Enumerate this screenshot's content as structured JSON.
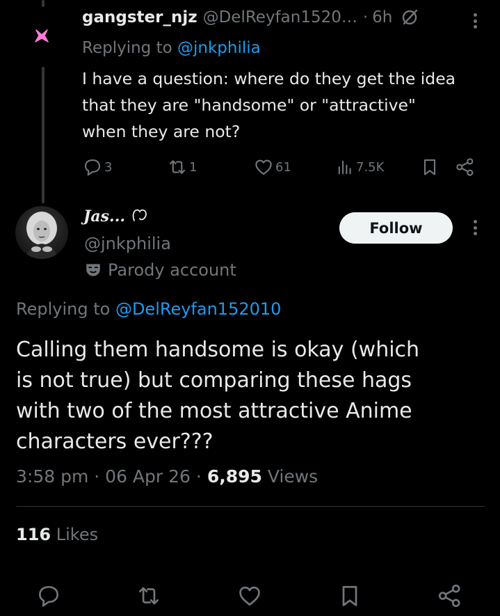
{
  "colors": {
    "background": "#000000",
    "primary_text": "#e7e9ea",
    "secondary_text": "#71767b",
    "link": "#1d9bf0",
    "follow_button_bg": "#eff3f4",
    "follow_button_text": "#0f1419",
    "divider": "#2f3336",
    "reply_avatar_accent": "#ff7ad9"
  },
  "reply": {
    "display_name": "gangster_njz",
    "handle": "@DelReyfan1520…",
    "separator": "·",
    "time": "6h",
    "grok_icon": "grok-icon",
    "avatar_icon": "pink-bunny-avatar",
    "replying_prefix": "Replying to",
    "replying_handle": "@jnkphilia",
    "text_lines": [
      "I have a question: where do they get the idea",
      "that they are \"handsome\" or \"attractive\"",
      "when they are not?"
    ],
    "actions": {
      "replies": "3",
      "reposts": "1",
      "likes": "61",
      "views": "7.5K"
    }
  },
  "main_tweet": {
    "display_name": "Jas...",
    "name_icon": "heart-outline-icon",
    "handle": "@jnkphilia",
    "avatar_icon": "profile-photo-avatar",
    "label_icon": "theater-mask-icon",
    "label_text": "Parody account",
    "follow_label": "Follow",
    "replying_prefix": "Replying to",
    "replying_handle": "@DelReyfan152010",
    "text_lines": [
      "Calling them handsome is okay (which",
      "is not true) but comparing these hags",
      "with two of the most attractive Anime",
      "characters ever???"
    ],
    "time": "3:58 pm",
    "date": "06 Apr 26",
    "sep": "·",
    "views_count": "6,895",
    "views_label": "Views",
    "likes_count": "116",
    "likes_label": "Likes"
  },
  "bottom_bar": {
    "icons": [
      "reply-icon",
      "repost-icon",
      "like-icon",
      "bookmark-icon",
      "share-icon"
    ]
  }
}
